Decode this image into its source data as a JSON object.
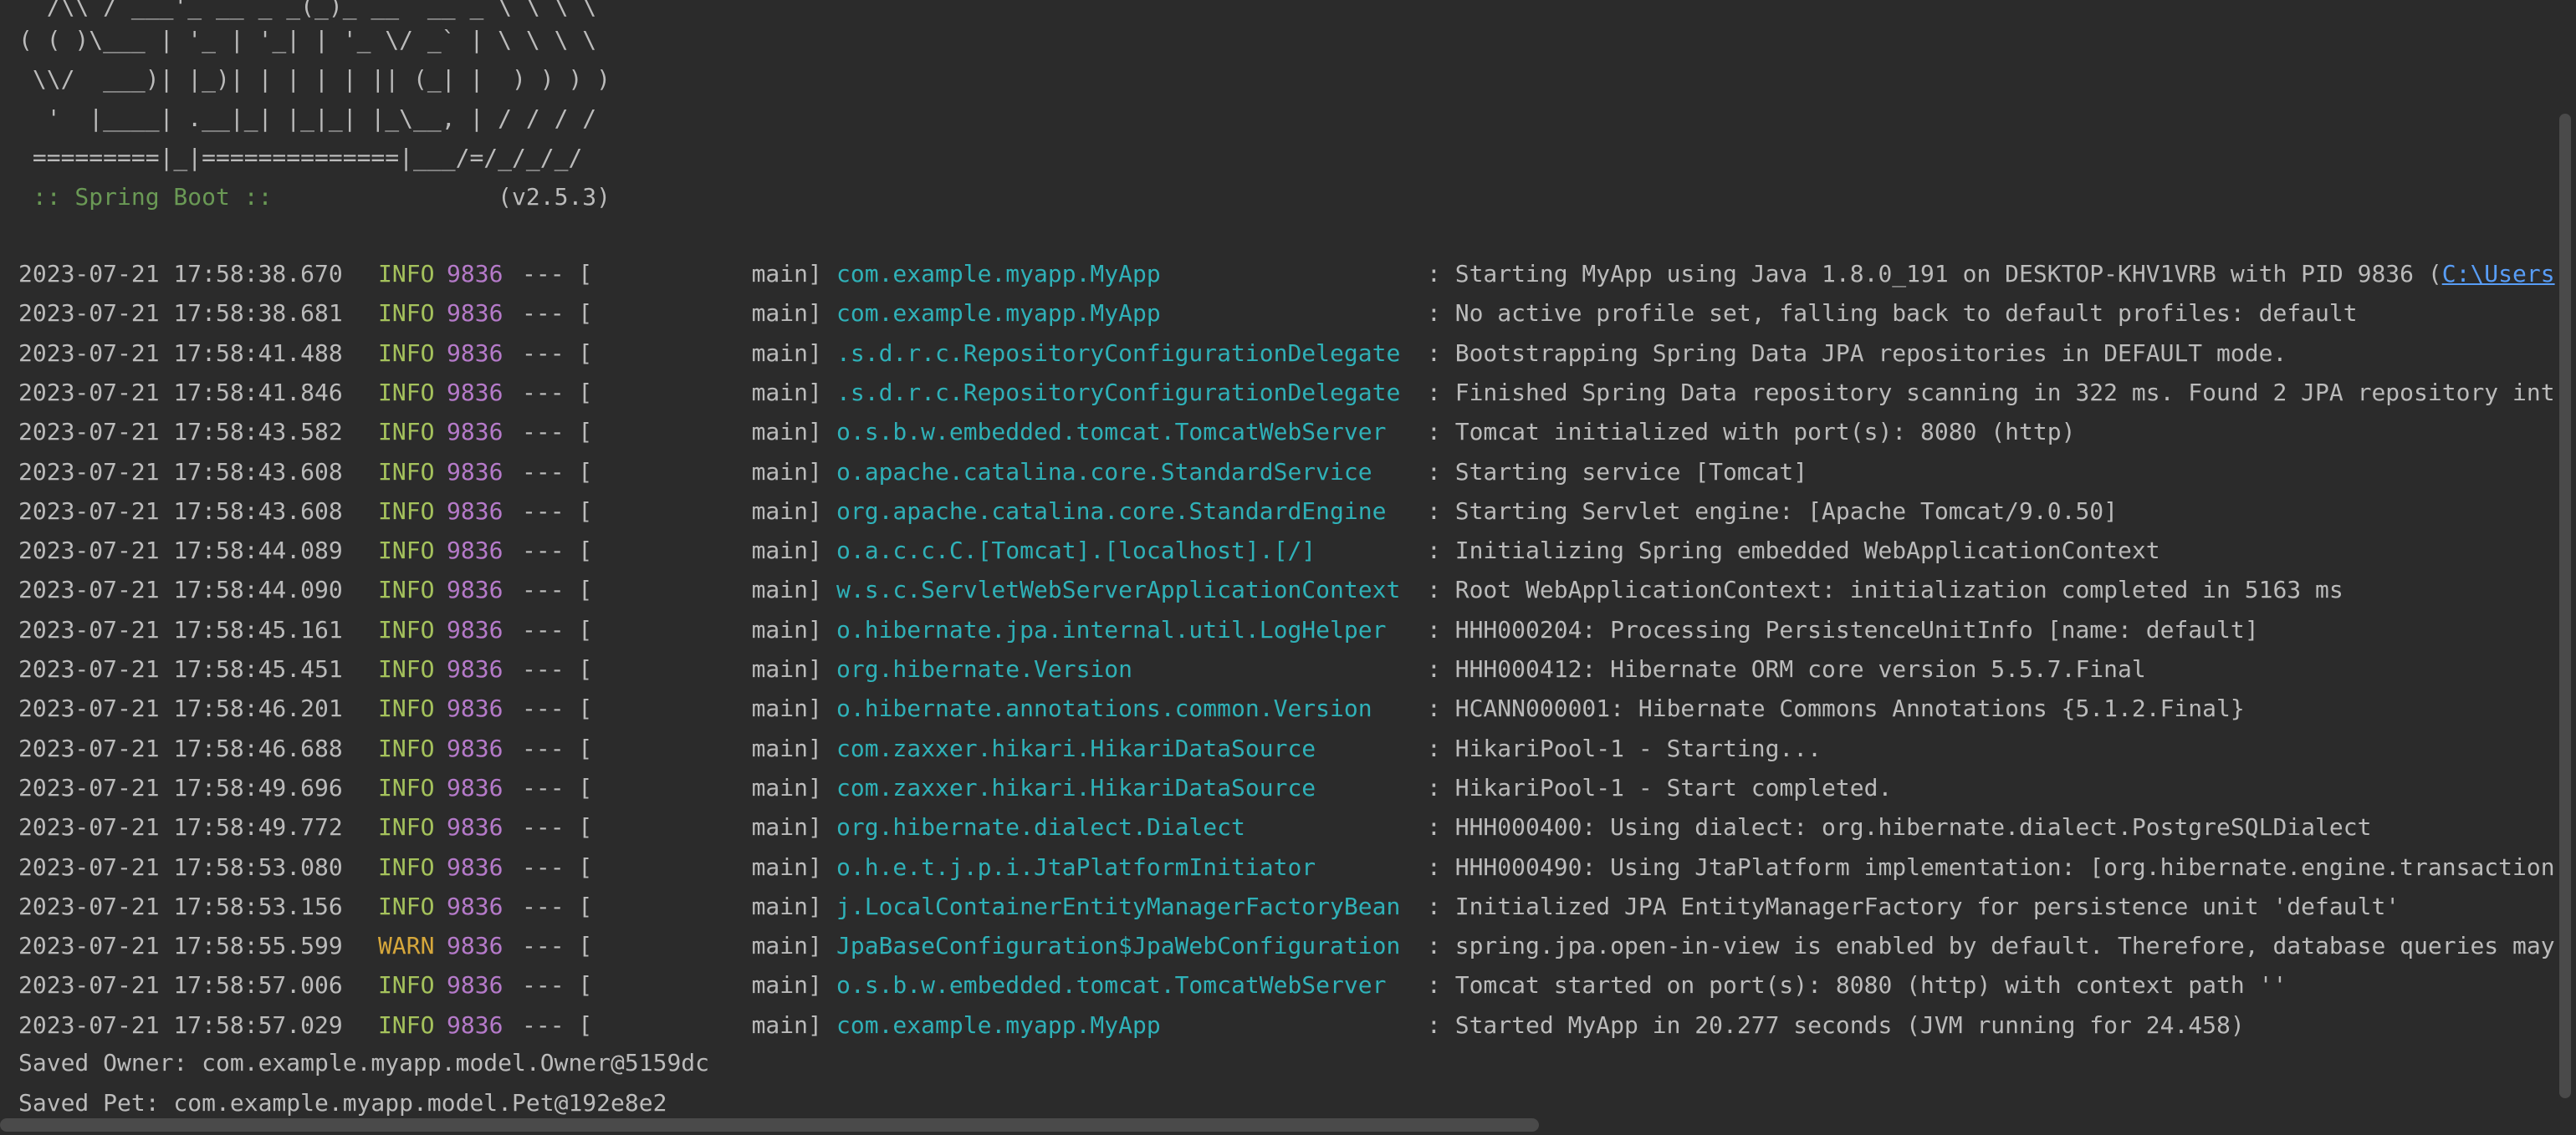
{
  "banner": {
    "lines": [
      "  /\\\\ / ___'_ __ _ _(_)_ __  __ _ \\ \\ \\ \\",
      "( ( )\\___ | '_ | '_| | '_ \\/ _` | \\ \\ \\ \\",
      " \\\\/  ___)| |_)| | | | | || (_| |  ) ) ) )",
      "  '  |____| .__|_| |_|_| |_\\__, | / / / /",
      " =========|_|==============|___/=/_/_/_/"
    ],
    "spring_label": " :: Spring Boot :: ",
    "version": "               (v2.5.3)"
  },
  "logs": [
    {
      "ts": "2023-07-21 17:58:38.670",
      "level": "INFO",
      "pid": "9836",
      "sep": "--- [",
      "thread": "          main]",
      "logger": "com.example.myapp.MyApp",
      "msg": ": Starting MyApp using Java 1.8.0_191 on DESKTOP-KHV1VRB with PID 9836 (",
      "link": "C:\\Users"
    },
    {
      "ts": "2023-07-21 17:58:38.681",
      "level": "INFO",
      "pid": "9836",
      "sep": "--- [",
      "thread": "          main]",
      "logger": "com.example.myapp.MyApp",
      "msg": ": No active profile set, falling back to default profiles: default"
    },
    {
      "ts": "2023-07-21 17:58:41.488",
      "level": "INFO",
      "pid": "9836",
      "sep": "--- [",
      "thread": "          main]",
      "logger": ".s.d.r.c.RepositoryConfigurationDelegate",
      "msg": ": Bootstrapping Spring Data JPA repositories in DEFAULT mode."
    },
    {
      "ts": "2023-07-21 17:58:41.846",
      "level": "INFO",
      "pid": "9836",
      "sep": "--- [",
      "thread": "          main]",
      "logger": ".s.d.r.c.RepositoryConfigurationDelegate",
      "msg": ": Finished Spring Data repository scanning in 322 ms. Found 2 JPA repository int"
    },
    {
      "ts": "2023-07-21 17:58:43.582",
      "level": "INFO",
      "pid": "9836",
      "sep": "--- [",
      "thread": "          main]",
      "logger": "o.s.b.w.embedded.tomcat.TomcatWebServer",
      "msg": ": Tomcat initialized with port(s): 8080 (http)"
    },
    {
      "ts": "2023-07-21 17:58:43.608",
      "level": "INFO",
      "pid": "9836",
      "sep": "--- [",
      "thread": "          main]",
      "logger": "o.apache.catalina.core.StandardService",
      "msg": ": Starting service [Tomcat]"
    },
    {
      "ts": "2023-07-21 17:58:43.608",
      "level": "INFO",
      "pid": "9836",
      "sep": "--- [",
      "thread": "          main]",
      "logger": "org.apache.catalina.core.StandardEngine",
      "msg": ": Starting Servlet engine: [Apache Tomcat/9.0.50]"
    },
    {
      "ts": "2023-07-21 17:58:44.089",
      "level": "INFO",
      "pid": "9836",
      "sep": "--- [",
      "thread": "          main]",
      "logger": "o.a.c.c.C.[Tomcat].[localhost].[/]",
      "msg": ": Initializing Spring embedded WebApplicationContext"
    },
    {
      "ts": "2023-07-21 17:58:44.090",
      "level": "INFO",
      "pid": "9836",
      "sep": "--- [",
      "thread": "          main]",
      "logger": "w.s.c.ServletWebServerApplicationContext",
      "msg": ": Root WebApplicationContext: initialization completed in 5163 ms"
    },
    {
      "ts": "2023-07-21 17:58:45.161",
      "level": "INFO",
      "pid": "9836",
      "sep": "--- [",
      "thread": "          main]",
      "logger": "o.hibernate.jpa.internal.util.LogHelper",
      "msg": ": HHH000204: Processing PersistenceUnitInfo [name: default]"
    },
    {
      "ts": "2023-07-21 17:58:45.451",
      "level": "INFO",
      "pid": "9836",
      "sep": "--- [",
      "thread": "          main]",
      "logger": "org.hibernate.Version",
      "msg": ": HHH000412: Hibernate ORM core version 5.5.7.Final"
    },
    {
      "ts": "2023-07-21 17:58:46.201",
      "level": "INFO",
      "pid": "9836",
      "sep": "--- [",
      "thread": "          main]",
      "logger": "o.hibernate.annotations.common.Version",
      "msg": ": HCANN000001: Hibernate Commons Annotations {5.1.2.Final}"
    },
    {
      "ts": "2023-07-21 17:58:46.688",
      "level": "INFO",
      "pid": "9836",
      "sep": "--- [",
      "thread": "          main]",
      "logger": "com.zaxxer.hikari.HikariDataSource",
      "msg": ": HikariPool-1 - Starting..."
    },
    {
      "ts": "2023-07-21 17:58:49.696",
      "level": "INFO",
      "pid": "9836",
      "sep": "--- [",
      "thread": "          main]",
      "logger": "com.zaxxer.hikari.HikariDataSource",
      "msg": ": HikariPool-1 - Start completed."
    },
    {
      "ts": "2023-07-21 17:58:49.772",
      "level": "INFO",
      "pid": "9836",
      "sep": "--- [",
      "thread": "          main]",
      "logger": "org.hibernate.dialect.Dialect",
      "msg": ": HHH000400: Using dialect: org.hibernate.dialect.PostgreSQLDialect"
    },
    {
      "ts": "2023-07-21 17:58:53.080",
      "level": "INFO",
      "pid": "9836",
      "sep": "--- [",
      "thread": "          main]",
      "logger": "o.h.e.t.j.p.i.JtaPlatformInitiator",
      "msg": ": HHH000490: Using JtaPlatform implementation: [org.hibernate.engine.transaction"
    },
    {
      "ts": "2023-07-21 17:58:53.156",
      "level": "INFO",
      "pid": "9836",
      "sep": "--- [",
      "thread": "          main]",
      "logger": "j.LocalContainerEntityManagerFactoryBean",
      "msg": ": Initialized JPA EntityManagerFactory for persistence unit 'default'"
    },
    {
      "ts": "2023-07-21 17:58:55.599",
      "level": "WARN",
      "pid": "9836",
      "sep": "--- [",
      "thread": "          main]",
      "logger": "JpaBaseConfiguration$JpaWebConfiguration",
      "msg": ": spring.jpa.open-in-view is enabled by default. Therefore, database queries may"
    },
    {
      "ts": "2023-07-21 17:58:57.006",
      "level": "INFO",
      "pid": "9836",
      "sep": "--- [",
      "thread": "          main]",
      "logger": "o.s.b.w.embedded.tomcat.TomcatWebServer",
      "msg": ": Tomcat started on port(s): 8080 (http) with context path ''"
    },
    {
      "ts": "2023-07-21 17:58:57.029",
      "level": "INFO",
      "pid": "9836",
      "sep": "--- [",
      "thread": "          main]",
      "logger": "com.example.myapp.MyApp",
      "msg": ": Started MyApp in 20.277 seconds (JVM running for 24.458)"
    }
  ],
  "output": [
    "Saved Owner: com.example.myapp.model.Owner@5159dc",
    "Saved Pet: com.example.myapp.model.Pet@192e8e2"
  ]
}
